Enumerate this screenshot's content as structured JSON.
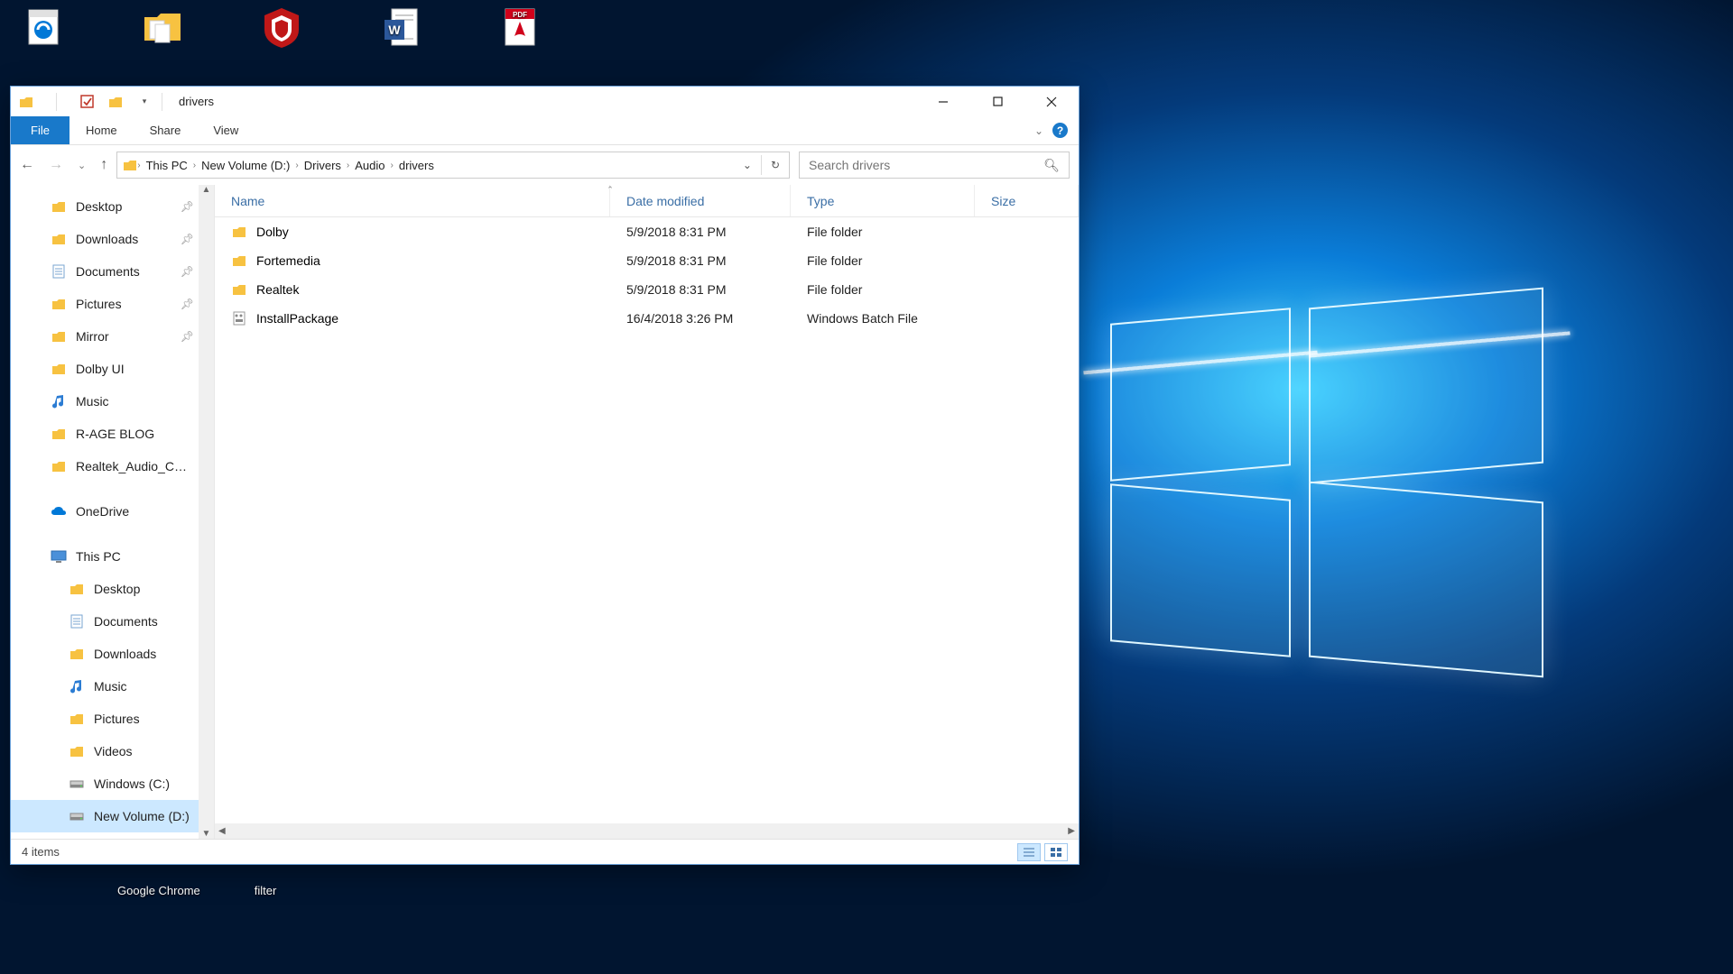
{
  "desktop": {
    "icons": [
      {
        "label": "",
        "kind": "edge"
      },
      {
        "label": "",
        "kind": "folder"
      },
      {
        "label": "",
        "kind": "mcafee"
      },
      {
        "label": "",
        "kind": "word"
      },
      {
        "label": "",
        "kind": "pdf"
      }
    ],
    "taskbar_remnants": [
      "Google Chrome",
      "filter"
    ]
  },
  "window": {
    "title": "drivers",
    "tabs": {
      "file": "File",
      "home": "Home",
      "share": "Share",
      "view": "View"
    },
    "win_controls": {
      "min": "—",
      "max": "▢",
      "close": "✕"
    },
    "breadcrumbs": [
      "This PC",
      "New Volume (D:)",
      "Drivers",
      "Audio",
      "drivers"
    ],
    "search_placeholder": "Search drivers",
    "columns": {
      "name": "Name",
      "date": "Date modified",
      "type": "Type",
      "size": "Size"
    },
    "status": "4 items"
  },
  "navpane": {
    "quick": [
      {
        "label": "Desktop",
        "icon": "folder",
        "pinned": true
      },
      {
        "label": "Downloads",
        "icon": "folder",
        "pinned": true
      },
      {
        "label": "Documents",
        "icon": "documents",
        "pinned": true
      },
      {
        "label": "Pictures",
        "icon": "folder",
        "pinned": true
      },
      {
        "label": "Mirror",
        "icon": "folder",
        "pinned": true
      },
      {
        "label": "Dolby UI",
        "icon": "folder",
        "pinned": false
      },
      {
        "label": "Music",
        "icon": "music",
        "pinned": false
      },
      {
        "label": "R-AGE BLOG",
        "icon": "folder",
        "pinned": false
      },
      {
        "label": "Realtek_Audio_C…",
        "icon": "folder",
        "pinned": false
      }
    ],
    "onedrive": "OneDrive",
    "thispc": {
      "label": "This PC",
      "children": [
        {
          "label": "Desktop",
          "icon": "folder"
        },
        {
          "label": "Documents",
          "icon": "documents"
        },
        {
          "label": "Downloads",
          "icon": "folder"
        },
        {
          "label": "Music",
          "icon": "music"
        },
        {
          "label": "Pictures",
          "icon": "folder"
        },
        {
          "label": "Videos",
          "icon": "folder"
        },
        {
          "label": "Windows (C:)",
          "icon": "drive"
        },
        {
          "label": "New Volume (D:)",
          "icon": "drive",
          "selected": true
        }
      ]
    }
  },
  "files": [
    {
      "name": "Dolby",
      "date": "5/9/2018 8:31 PM",
      "type": "File folder",
      "size": "",
      "icon": "folder"
    },
    {
      "name": "Fortemedia",
      "date": "5/9/2018 8:31 PM",
      "type": "File folder",
      "size": "",
      "icon": "folder"
    },
    {
      "name": "Realtek",
      "date": "5/9/2018 8:31 PM",
      "type": "File folder",
      "size": "",
      "icon": "folder"
    },
    {
      "name": "InstallPackage",
      "date": "16/4/2018 3:26 PM",
      "type": "Windows Batch File",
      "size": "",
      "icon": "batch"
    }
  ]
}
